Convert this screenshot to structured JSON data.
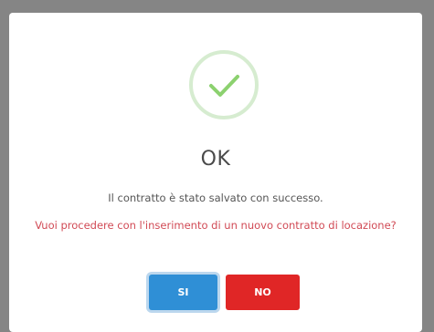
{
  "dialog": {
    "icon": "check-icon",
    "title": "OK",
    "message": "Il contratto è stato salvato con successo.",
    "question": "Vuoi procedere con l'inserimento di un nuovo contratto di locazione?",
    "confirm_label": "SI",
    "cancel_label": "NO"
  },
  "colors": {
    "confirm": "#2f8fd6",
    "cancel": "#e02626",
    "success": "#8cd16f",
    "question_text": "#d14a55"
  }
}
